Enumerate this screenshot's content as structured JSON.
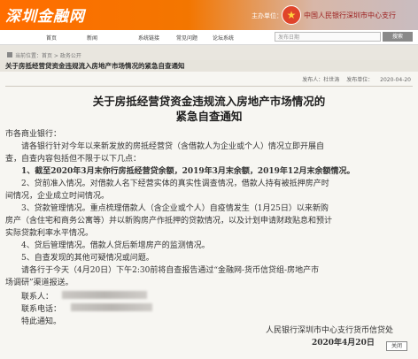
{
  "site": {
    "logo": "深圳金融网",
    "tagline": "主办单位：",
    "bank_name": "中国人民银行深圳市中心支行"
  },
  "nav": {
    "items": [
      "首页",
      "新闻",
      "系统链接",
      "常见问题",
      "论坛系统"
    ],
    "search_placeholder": "发布日期",
    "search_button": "搜索"
  },
  "breadcrumb": {
    "text": "当前位置：首页 > 政务公开"
  },
  "article": {
    "topbar_title": "关于房抵经营贷资金违规流入房地产市场情况的紧急自查通知",
    "meta": {
      "source": "发布人：",
      "author": "杜世涛",
      "unit": "发布单位：",
      "date": "2020-04-20"
    },
    "title_line1": "关于房抵经营贷资金违规流入房地产市场情况的",
    "title_line2": "紧急自查通知",
    "lines": [
      "市各商业银行：",
      "请各银行针对今年以来新发放的房抵经营贷（含借款人为企业或个人）情况立即开展自",
      "查，自查内容包括但不限于以下几点：",
      "1、截至2020年3月末你行房抵经营贷余额，2019年3月末余额，2019年12月末余额情况。",
      "2、贷前准入情况。对借款人名下经营实体的真实性调查情况，借款人持有被抵押房产时",
      "间情况，企业成立时间情况。",
      "3、贷款管理情况。重点梳理借款人（含企业或个人）自疫情发生（1月25日）以来新购",
      "房产（含住宅和商务公寓等）并以新购房产作抵押的贷款情况，以及计划申请财政贴息和预计",
      "实际贷款利率水平情况。",
      "4、贷后管理情况。借款人贷后新增房产的监测情况。",
      "5、自查发现的其他可疑情况或问题。",
      "请各行于今天（4月20日）下午2:30前将自查报告通过“金融网-货币信贷组-房地产市",
      "场调研”渠道报送。",
      "联系人：",
      "联系电话：",
      "特此通知。"
    ],
    "signature_org": "人民银行深圳市中心支行货币信贷处",
    "signature_date": "2020年4月20日",
    "close_label": "关闭"
  }
}
